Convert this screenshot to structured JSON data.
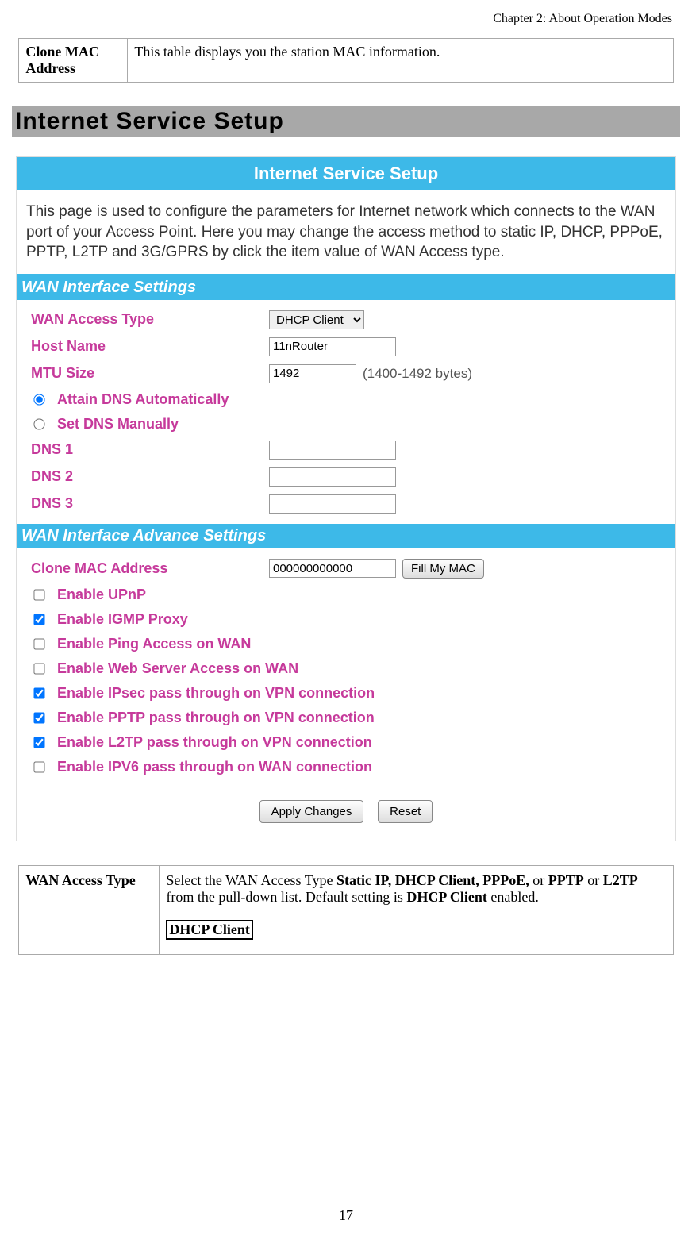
{
  "chapter": "Chapter 2: About Operation Modes",
  "top_def": {
    "term": "Clone MAC Address",
    "desc": "This table displays you the station MAC information."
  },
  "banner": "Internet Service Setup",
  "shot": {
    "title": "Internet Service Setup",
    "desc": "This page is used to configure the parameters for Internet network which connects to the WAN port of your Access Point. Here you may change the access method to static IP, DHCP, PPPoE, PPTP, L2TP and 3G/GPRS by click the item value of WAN Access type.",
    "sub1": "WAN Interface Settings",
    "wan_access_label": "WAN Access Type",
    "wan_access_value": "DHCP Client",
    "host_label": "Host Name",
    "host_value": "11nRouter",
    "mtu_label": "MTU Size",
    "mtu_value": "1492",
    "mtu_hint": "(1400-1492 bytes)",
    "dns_auto": "Attain DNS Automatically",
    "dns_manual": "Set DNS Manually",
    "dns1_label": "DNS 1",
    "dns2_label": "DNS 2",
    "dns3_label": "DNS 3",
    "sub2": "WAN Interface Advance Settings",
    "clone_label": "Clone MAC Address",
    "clone_value": "000000000000",
    "fill_btn": "Fill My MAC",
    "checks": [
      {
        "label": "Enable UPnP",
        "checked": false
      },
      {
        "label": "Enable IGMP Proxy",
        "checked": true
      },
      {
        "label": "Enable Ping Access on WAN",
        "checked": false
      },
      {
        "label": "Enable Web Server Access on WAN",
        "checked": false
      },
      {
        "label": "Enable IPsec pass through on VPN connection",
        "checked": true
      },
      {
        "label": "Enable PPTP pass through on VPN connection",
        "checked": true
      },
      {
        "label": "Enable L2TP pass through on VPN connection",
        "checked": true
      },
      {
        "label": "Enable IPV6 pass through on WAN connection",
        "checked": false
      }
    ],
    "apply_btn": "Apply Changes",
    "reset_btn": "Reset"
  },
  "bottom_def": {
    "term": "WAN Access Type",
    "desc_pre": "Select the WAN Access Type ",
    "bold1": "Static IP, DHCP Client, PPPoE,",
    "desc_mid1": " or ",
    "bold2": "PPTP",
    "desc_mid2": " or ",
    "bold3": "L2TP",
    "desc_mid3": " from the pull-down list. Default setting is ",
    "bold4": "DHCP Client",
    "desc_post": " enabled.",
    "boxed": "DHCP Client"
  },
  "page_num": "17"
}
